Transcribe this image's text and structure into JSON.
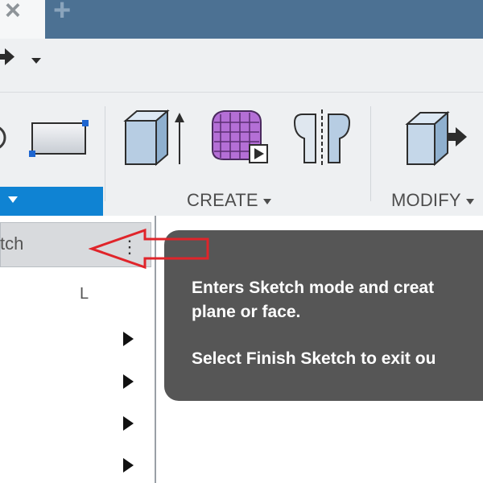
{
  "tabs": {
    "close_glyph": "×",
    "new_tab_glyph": "+"
  },
  "ribbon": {
    "create_label": "CREATE",
    "modify_label": "MODIFY"
  },
  "dropdown": {
    "selected_item_label": "tch",
    "selected_item_more": "⋮",
    "second_item_shortcut": "L",
    "submenu_rows": 4
  },
  "tooltip": {
    "line1": "Enters Sketch mode and creat",
    "line2": "plane or face.",
    "line3": "Select Finish Sketch to exit ou"
  },
  "colors": {
    "tab_bar": "#4c7193",
    "active_group": "#0f83d3",
    "tooltip_bg": "#565656",
    "annotation": "#e0242a"
  }
}
